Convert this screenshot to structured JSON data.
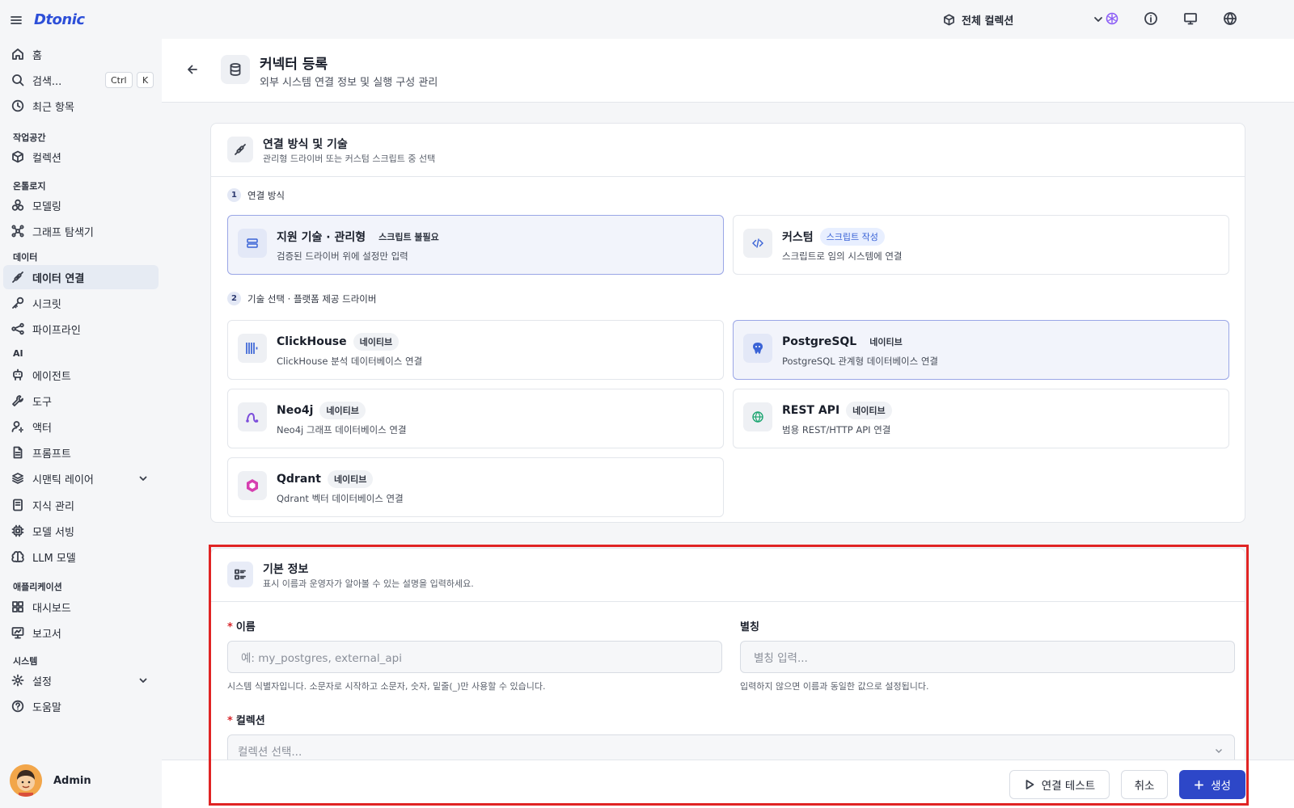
{
  "app": {
    "logo": "Dtonic"
  },
  "sidebar": {
    "items": [
      {
        "label": "홈"
      },
      {
        "label": "검색..."
      },
      {
        "label": "최근 항목"
      },
      {
        "label": "컬렉션"
      },
      {
        "label": "모델링"
      },
      {
        "label": "그래프 탐색기"
      },
      {
        "label": "데이터 연결"
      },
      {
        "label": "시크릿"
      },
      {
        "label": "파이프라인"
      },
      {
        "label": "에이전트"
      },
      {
        "label": "도구"
      },
      {
        "label": "액터"
      },
      {
        "label": "프롬프트"
      },
      {
        "label": "시맨틱 레이어"
      },
      {
        "label": "지식 관리"
      },
      {
        "label": "모델 서빙"
      },
      {
        "label": "LLM 모델"
      },
      {
        "label": "대시보드"
      },
      {
        "label": "보고서"
      },
      {
        "label": "설정"
      },
      {
        "label": "도움말"
      }
    ],
    "sections": [
      "작업공간",
      "온톨로지",
      "데이터",
      "AI",
      "애플리케이션",
      "시스템"
    ],
    "shortcut": [
      "Ctrl",
      "K"
    ],
    "user": {
      "name": "Admin"
    }
  },
  "topbar": {
    "collection": "전체 컬렉션"
  },
  "header": {
    "title": "커넥터 등록",
    "subtitle": "외부 시스템 연결 정보 및 실행 구성 관리"
  },
  "connection": {
    "title": "연결 방식 및 기술",
    "subtitle": "관리형 드라이버 또는 커스텀 스크립트 중 선택",
    "step1": {
      "num": "1",
      "label": "연결 방식"
    },
    "modes": [
      {
        "name": "지원 기술 · 관리형",
        "badge": "스크립트 불필요",
        "desc": "검증된 드라이버 위에 설정만 입력",
        "selected": true
      },
      {
        "name": "커스텀",
        "badge": "스크립트 작성",
        "desc": "스크립트로 임의 시스템에 연결",
        "selected": false
      }
    ],
    "step2": {
      "num": "2",
      "label": "기술 선택 · 플랫폼 제공 드라이버"
    },
    "techs": [
      {
        "name": "ClickHouse",
        "badge": "네이티브",
        "desc": "ClickHouse 분석 데이터베이스 연결",
        "icon": "clickhouse-icon",
        "selected": false
      },
      {
        "name": "PostgreSQL",
        "badge": "네이티브",
        "desc": "PostgreSQL 관계형 데이터베이스 연결",
        "icon": "postgresql-icon",
        "selected": true
      },
      {
        "name": "Neo4j",
        "badge": "네이티브",
        "desc": "Neo4j 그래프 데이터베이스 연결",
        "icon": "neo4j-icon",
        "selected": false
      },
      {
        "name": "REST API",
        "badge": "네이티브",
        "desc": "범용 REST/HTTP API 연결",
        "icon": "globe-icon",
        "selected": false
      },
      {
        "name": "Qdrant",
        "badge": "네이티브",
        "desc": "Qdrant 벡터 데이터베이스 연결",
        "icon": "qdrant-icon",
        "selected": false
      }
    ]
  },
  "basic": {
    "title": "기본 정보",
    "subtitle": "표시 이름과 운영자가 알아볼 수 있는 설명을 입력하세요.",
    "name": {
      "required": "*",
      "label": "이름",
      "placeholder": "예: my_postgres, external_api",
      "help": "시스템 식별자입니다. 소문자로 시작하고 소문자, 숫자, 밑줄(_)만 사용할 수 있습니다."
    },
    "alias": {
      "label": "별칭",
      "placeholder": "별칭 입력...",
      "help": "입력하지 않으면 이름과 동일한 값으로 설정됩니다."
    },
    "collection": {
      "required": "*",
      "label": "컬렉션",
      "placeholder": "컬렉션 선택..."
    }
  },
  "footer": {
    "test": "연결 테스트",
    "cancel": "취소",
    "create": "생성"
  },
  "colors": {
    "accent": "#2d47c8",
    "highlight": "#e02424",
    "selected_border": "#9aa6e6"
  }
}
